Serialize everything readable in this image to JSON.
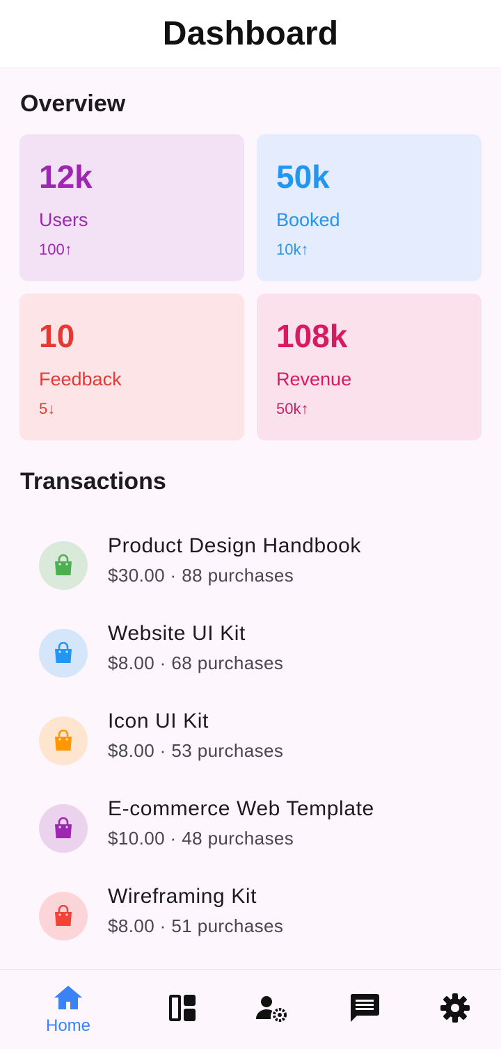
{
  "app_bar": {
    "title": "Dashboard"
  },
  "overview": {
    "title": "Overview",
    "cards": [
      {
        "value": "12k",
        "label": "Users",
        "change": "100↑",
        "color": "#9c27b0",
        "bg": "#f3e2f6"
      },
      {
        "value": "50k",
        "label": "Booked",
        "change": "10k↑",
        "color": "#2196f3",
        "bg": "#e4ecfd"
      },
      {
        "value": "10",
        "label": "Feedback",
        "change": "5↓",
        "color": "#e53935",
        "bg": "#fde4e7"
      },
      {
        "value": "108k",
        "label": "Revenue",
        "change": "50k↑",
        "color": "#d81b60",
        "bg": "#fbe1ec"
      }
    ]
  },
  "transactions": {
    "title": "Transactions",
    "items": [
      {
        "title": "Product Design Handbook",
        "subtitle": "$30.00 · 88 purchases",
        "icon": "shopping-bag-icon",
        "color": "#4caf50",
        "bg": "#d9eadb"
      },
      {
        "title": "Website UI Kit",
        "subtitle": "$8.00 · 68 purchases",
        "icon": "shopping-bag-icon",
        "color": "#2196f3",
        "bg": "#d5e6fb"
      },
      {
        "title": "Icon UI Kit",
        "subtitle": "$8.00 · 53 purchases",
        "icon": "shopping-bag-icon",
        "color": "#ff9800",
        "bg": "#fde5cf"
      },
      {
        "title": "E-commerce Web Template",
        "subtitle": "$10.00 · 48 purchases",
        "icon": "shopping-bag-icon",
        "color": "#9c27b0",
        "bg": "#ebd3ee"
      },
      {
        "title": "Wireframing Kit",
        "subtitle": "$8.00 · 51 purchases",
        "icon": "shopping-bag-icon",
        "color": "#f44336",
        "bg": "#fbd5d7"
      }
    ]
  },
  "nav": {
    "active_color": "#3b82f6",
    "items": [
      {
        "label": "Home",
        "icon": "home-icon",
        "active": true
      },
      {
        "label": "",
        "icon": "dashboard-icon",
        "active": false
      },
      {
        "label": "",
        "icon": "manage-accounts-icon",
        "active": false
      },
      {
        "label": "",
        "icon": "chat-icon",
        "active": false
      },
      {
        "label": "",
        "icon": "settings-icon",
        "active": false
      }
    ]
  }
}
